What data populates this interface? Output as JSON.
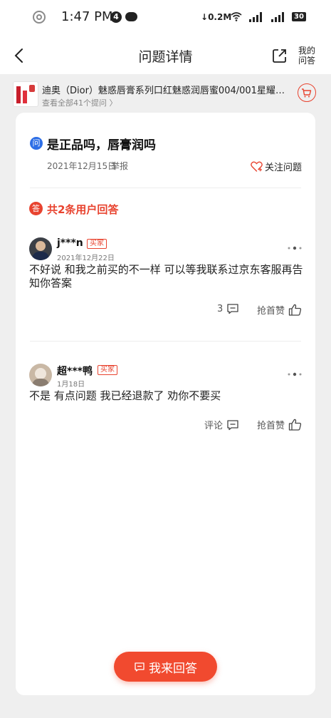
{
  "status_bar": {
    "time": "1:47 PM",
    "notification_count": "4",
    "network_speed": "0.2M",
    "battery": "30"
  },
  "nav": {
    "title": "问题详情",
    "my_qa_line1": "我的",
    "my_qa_line2": "问答"
  },
  "product": {
    "title": "迪奥（Dior）魅惑唇膏系列口红魅惑润唇蜜004/001星耀唇...",
    "subtitle": "查看全部41个提问 〉"
  },
  "question": {
    "icon_text": "问",
    "title": "是正品吗，唇膏润吗",
    "date": "2021年12月15日",
    "report": "举报",
    "follow": "关注问题"
  },
  "answers_header": {
    "icon_text": "答",
    "count_text": "共2条用户回答"
  },
  "answers": [
    {
      "name": "j***n",
      "tag": "买家",
      "date": "2021年12月22日",
      "text": "不好说 和我之前买的不一样 可以等我联系过京东客服再告知你答案",
      "comment_label": "3",
      "like_label": "抢首赞"
    },
    {
      "name": "超***鸭",
      "tag": "买家",
      "date": "1月18日",
      "text": "不是 有点问题 我已经退款了 劝你不要买",
      "comment_label": "评论",
      "like_label": "抢首赞"
    }
  ],
  "answer_button": "我来回答",
  "colors": {
    "accent": "#e8432f",
    "question_blue": "#2d6ee6",
    "button": "#f14a2f"
  }
}
